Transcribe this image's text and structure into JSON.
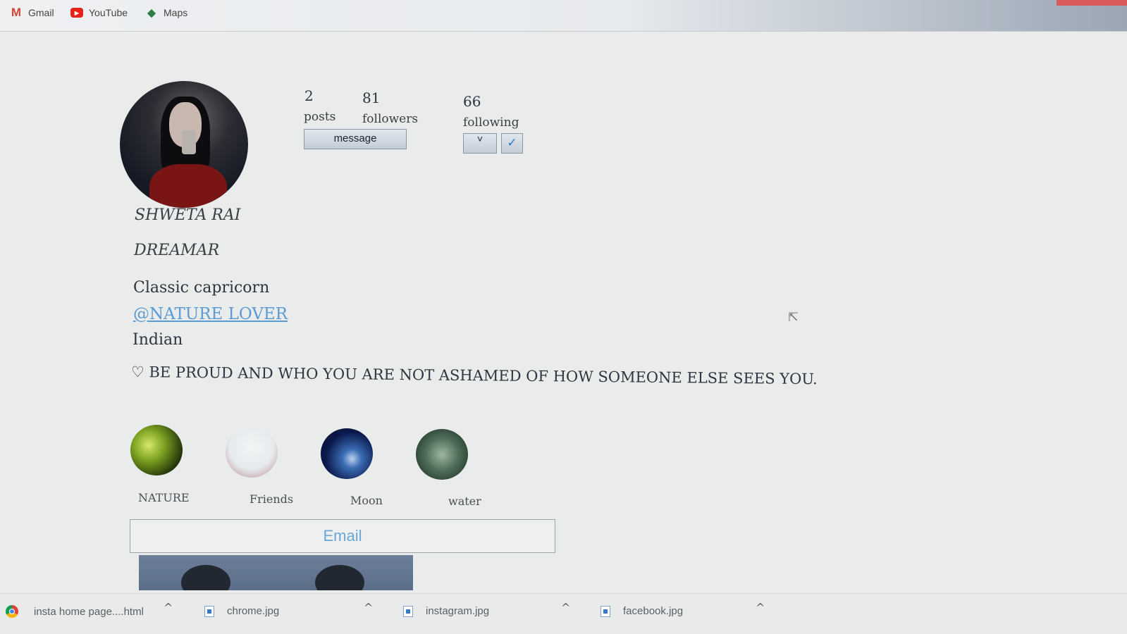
{
  "bookmarks": [
    {
      "label": "Gmail",
      "icon": "gmail-icon"
    },
    {
      "label": "YouTube",
      "icon": "youtube-icon"
    },
    {
      "label": "Maps",
      "icon": "maps-icon"
    }
  ],
  "profile": {
    "stats": {
      "posts_count": "2",
      "posts_label": "posts",
      "followers_count": "81",
      "followers_label": "followers",
      "following_count": "66",
      "following_label": "following"
    },
    "message_button": "message",
    "dropdown_button": "˅",
    "check_button": "✓",
    "name": "SHWETA RAI",
    "motto": "DREAMAR",
    "bio_line1": "Classic capricorn",
    "bio_link": "@NATURE LOVER",
    "bio_line3": "Indian",
    "quote": "♡ BE PROUD AND WHO YOU ARE NOT ASHAMED OF HOW SOMEONE ELSE SEES YOU."
  },
  "highlights": [
    {
      "label": "NATURE"
    },
    {
      "label": "Friends"
    },
    {
      "label": "Moon"
    },
    {
      "label": "water"
    }
  ],
  "email_field": {
    "placeholder": "Email",
    "value": ""
  },
  "downloads": [
    {
      "name": "insta home page....html"
    },
    {
      "name": "chrome.jpg"
    },
    {
      "name": "instagram.jpg"
    },
    {
      "name": "facebook.jpg"
    }
  ],
  "icons": {
    "chevron_up": "^",
    "cursor": "⇱"
  }
}
